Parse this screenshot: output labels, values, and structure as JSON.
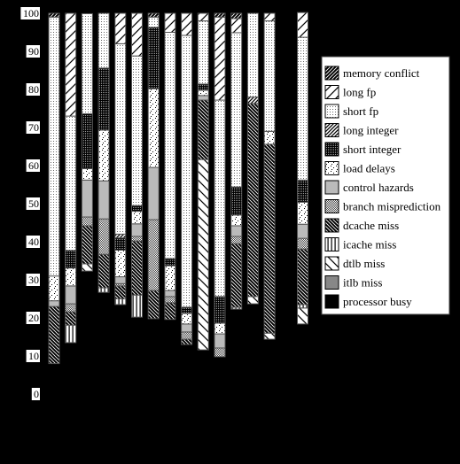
{
  "chart_data": {
    "type": "bar",
    "stacked": true,
    "title": "",
    "xlabel": "",
    "ylabel": "",
    "ylim": [
      0,
      100
    ],
    "yticks": [
      "0",
      "10",
      "20",
      "30",
      "40",
      "50",
      "60",
      "70",
      "80",
      "90",
      "100"
    ],
    "grid": false,
    "legend_position": "right",
    "categories": [
      "",
      "",
      "",
      "",
      "",
      "",
      "",
      "",
      "",
      "",
      "",
      "",
      "",
      "",
      "",
      ""
    ],
    "series": [
      {
        "name": "processor busy",
        "pattern": "solid-black",
        "values": [
          8,
          13.5,
          32.3,
          26.7,
          23.5,
          20.2,
          19.8,
          19.6,
          13,
          11.6,
          9.8,
          22.3,
          23.7,
          14.4,
          100,
          18.4
        ]
      },
      {
        "name": "itlb miss",
        "pattern": "dark-gray",
        "values": [
          0,
          0,
          0,
          0,
          0,
          0,
          0,
          0,
          0,
          0,
          0,
          0,
          0,
          0,
          0,
          0
        ]
      },
      {
        "name": "dtlb miss",
        "pattern": "sparse-backslash",
        "values": [
          0,
          0,
          1.9,
          0,
          0,
          0,
          0,
          0,
          0,
          50,
          0,
          0,
          1.9,
          1.6,
          0,
          4.2
        ]
      },
      {
        "name": "icache miss",
        "pattern": "vertical-lines",
        "values": [
          0,
          4.6,
          0,
          1.2,
          1.5,
          5.8,
          0,
          0,
          0,
          0,
          0,
          0.5,
          0,
          0,
          0,
          0.9
        ]
      },
      {
        "name": "dcache miss",
        "pattern": "dense-backslash",
        "values": [
          15,
          3.5,
          10,
          8.8,
          3.4,
          14.2,
          7.4,
          4.4,
          1.4,
          15.6,
          0,
          16.7,
          50.7,
          49.6,
          0,
          14.6
        ]
      },
      {
        "name": "branch misprediction",
        "pattern": "checker",
        "values": [
          0,
          2.1,
          2.3,
          9.3,
          0.6,
          1.2,
          18.6,
          1.6,
          1.9,
          0,
          2.3,
          1.9,
          0,
          0,
          0,
          2.8
        ]
      },
      {
        "name": "control hazards",
        "pattern": "light-gray",
        "values": [
          1.5,
          4.7,
          9.7,
          10,
          1.8,
          3.3,
          13.7,
          1.6,
          2.1,
          1.2,
          3.7,
          2.8,
          0,
          0,
          0,
          3.7
        ]
      },
      {
        "name": "load delays",
        "pattern": "sparse-dots",
        "values": [
          6.5,
          4.7,
          3,
          13.3,
          7,
          3.3,
          20.7,
          6.5,
          2.8,
          1.4,
          2.8,
          2.8,
          0,
          3.4,
          0,
          5.8
        ]
      },
      {
        "name": "short integer",
        "pattern": "black-grid",
        "values": [
          0,
          4.6,
          14.4,
          16.3,
          3.2,
          1.5,
          16.1,
          1.9,
          1.6,
          1.6,
          7,
          7.4,
          0,
          0,
          0,
          5.8
        ]
      },
      {
        "name": "long integer",
        "pattern": "dense-slash",
        "values": [
          0,
          0,
          0,
          0,
          1,
          0,
          0,
          0,
          0,
          0,
          0,
          0,
          1.7,
          0,
          0,
          0
        ]
      },
      {
        "name": "short fp",
        "pattern": "dot-grid",
        "values": [
          68,
          35.3,
          26.3,
          14.4,
          50,
          39.3,
          2.7,
          59.4,
          71.4,
          16.6,
          51.6,
          40.5,
          22,
          29,
          0,
          37.5
        ]
      },
      {
        "name": "long fp",
        "pattern": "sparse-slash",
        "values": [
          0,
          27,
          0,
          0,
          8,
          11.2,
          0,
          5,
          5.8,
          2,
          21.8,
          3.7,
          0,
          2,
          0,
          6.5
        ]
      },
      {
        "name": "memory conflict",
        "pattern": "black-slash",
        "values": [
          1,
          0,
          0,
          0,
          0,
          0,
          1,
          0,
          0,
          0,
          1,
          1.4,
          0,
          0,
          0,
          0
        ]
      }
    ]
  }
}
